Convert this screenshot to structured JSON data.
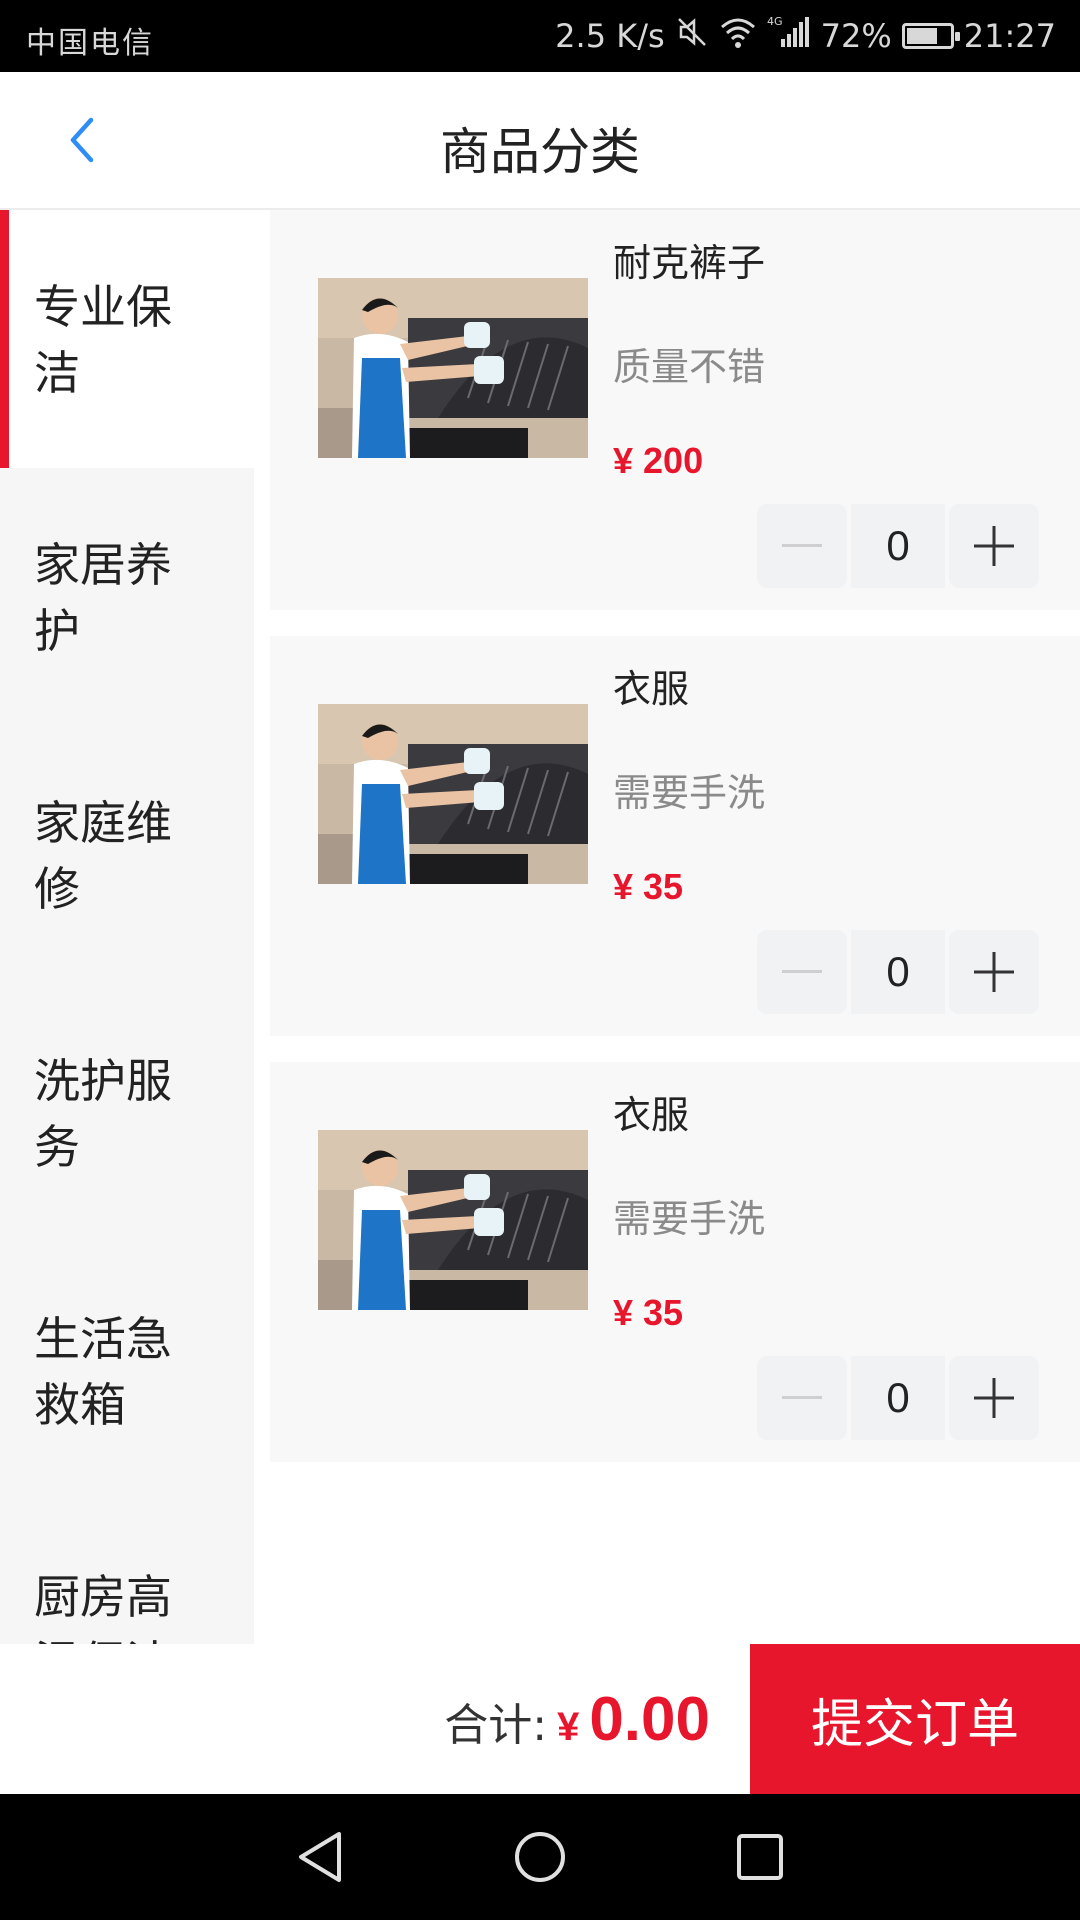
{
  "status_bar": {
    "carrier": "中国电信",
    "net_speed": "2.5 K/s",
    "network": "4G",
    "battery": "72%",
    "battery_level": 0.72,
    "time": "21:27"
  },
  "header": {
    "title": "商品分类"
  },
  "sidebar": {
    "items": [
      {
        "label": "专业保洁",
        "active": true
      },
      {
        "label": "家居养护",
        "active": false
      },
      {
        "label": "家庭维修",
        "active": false
      },
      {
        "label": "洗护服务",
        "active": false
      },
      {
        "label": "生活急救箱",
        "active": false
      },
      {
        "label": "厨房高温保洁",
        "active": false
      }
    ]
  },
  "products": [
    {
      "name": "耐克裤子",
      "desc": "质量不错",
      "price": "¥ 200",
      "qty": "0"
    },
    {
      "name": "衣服",
      "desc": "需要手洗",
      "price": "¥ 35",
      "qty": "0"
    },
    {
      "name": "衣服",
      "desc": "需要手洗",
      "price": "¥ 35",
      "qty": "0"
    }
  ],
  "footer": {
    "total_label": "合计:",
    "currency": "¥",
    "total_amount": "0.00",
    "submit_label": "提交订单"
  },
  "colors": {
    "accent": "#e8162d",
    "sidebar_bg": "#f6f6f6",
    "card_bg": "#f8f8f9"
  }
}
